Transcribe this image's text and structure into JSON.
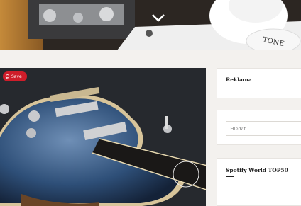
{
  "hero": {
    "chevron_icon": "chevron-down-icon",
    "knob_text": "TONE"
  },
  "post": {
    "save_label": "Save",
    "pin_icon": "pinterest-icon"
  },
  "sidebar": {
    "ads_title": "Reklama",
    "search_placeholder": "Hledat ...",
    "spotify_title": "Spotify World TOP50"
  },
  "colors": {
    "save_red": "#cf1d2a",
    "page_bg": "#f3f1ee",
    "widget_bg": "#ffffff"
  }
}
